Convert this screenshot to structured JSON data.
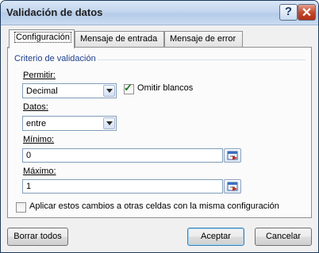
{
  "window": {
    "title": "Validación de datos"
  },
  "title_buttons": {
    "help": "?",
    "close": "✕"
  },
  "tabs": [
    {
      "label": "Configuración",
      "active": true
    },
    {
      "label": "Mensaje de entrada",
      "active": false
    },
    {
      "label": "Mensaje de error",
      "active": false
    }
  ],
  "criteria": {
    "group_title": "Criterio de validación",
    "allow_label": "Permitir:",
    "allow_value": "Decimal",
    "ignore_blank_label": "Omitir blancos",
    "ignore_blank_checked": true,
    "data_label": "Datos:",
    "data_value": "entre",
    "min_label": "Mínimo:",
    "min_value": "0",
    "max_label": "Máximo:",
    "max_value": "1"
  },
  "apply_all_label": "Aplicar estos cambios a otras celdas con la misma configuración",
  "apply_all_checked": false,
  "buttons": {
    "clear_all": "Borrar todos",
    "ok": "Aceptar",
    "cancel": "Cancelar"
  },
  "icons": {
    "combo_arrow": "chevron-down-icon",
    "range_selector": "collapse-dialog-icon",
    "checkmark": "checkmark-icon"
  }
}
